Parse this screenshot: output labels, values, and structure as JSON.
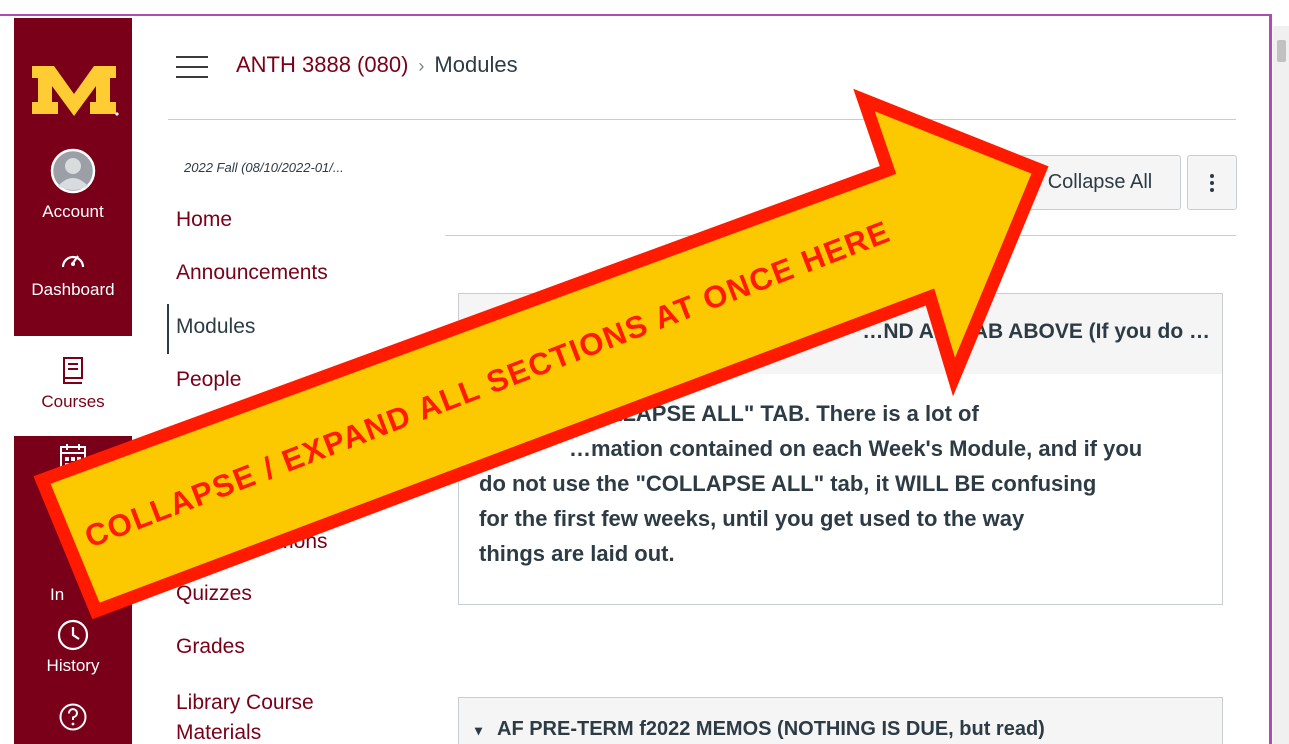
{
  "global_nav": {
    "items": [
      {
        "label": "Account",
        "icon": "avatar-icon"
      },
      {
        "label": "Dashboard",
        "icon": "dashboard-icon"
      },
      {
        "label": "Courses",
        "icon": "courses-icon",
        "active": true
      },
      {
        "label": "",
        "icon": "calendar-icon"
      },
      {
        "label": "History",
        "icon": "history-icon"
      },
      {
        "label": "",
        "icon": "help-icon"
      }
    ],
    "partial_label": "In"
  },
  "breadcrumb": {
    "course": "ANTH 3888 (080)",
    "separator": "›",
    "page": "Modules"
  },
  "course_nav": {
    "term": "2022 Fall (08/10/2022-01/...",
    "items": [
      "Home",
      "Announcements",
      "Modules",
      "People",
      "…ions",
      "Quizzes",
      "Grades",
      "Library Course Materials"
    ]
  },
  "toolbar": {
    "collapse_label": "Collapse All",
    "more_icon": "kebab-icon"
  },
  "modules": [
    {
      "title": "…ND AL… AB ABOVE (If you do …",
      "body": [
        "…LLAPSE ALL\" TAB. There is a lot of",
        "…mation contained on each Week's Module, and if you",
        "do not use the \"COLLAPSE ALL\" tab, it WILL BE confusing",
        "for the first few weeks, until you get used to the way",
        "things are laid out."
      ]
    },
    {
      "title": "AF PRE-TERM f2022 MEMOS (NOTHING IS DUE, but read)",
      "caret": "▾"
    }
  ],
  "annotation": {
    "text": "COLLAPSE / EXPAND ALL SECTIONS AT ONCE HERE"
  },
  "colors": {
    "brand": "#7a0019",
    "gold": "#ffcc33",
    "arrow_fill": "#fcc800",
    "arrow_stroke": "#ff1a00",
    "frame": "#b04bb0"
  }
}
